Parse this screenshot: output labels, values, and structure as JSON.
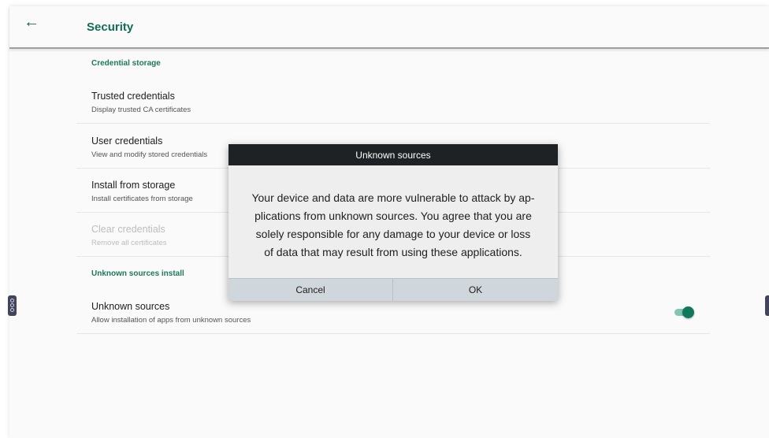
{
  "app": {
    "title": "Security",
    "back_icon": "arrow-left-icon",
    "accent_color": "#0f6e56"
  },
  "sections": {
    "credential_storage": "Credential storage",
    "unknown_sources_install": "Unknown sources install"
  },
  "prefs": {
    "trusted": {
      "title": "Trusted credentials",
      "summary": "Display trusted CA certificates"
    },
    "user": {
      "title": "User credentials",
      "summary": "View and modify stored credentials"
    },
    "install": {
      "title": "Install from storage",
      "summary": "Install certificates from storage"
    },
    "clear": {
      "title": "Clear credentials",
      "summary": "Remove all certificates",
      "enabled": false
    },
    "unknown": {
      "title": "Unknown sources",
      "summary": "Allow installation of apps from unknown sources",
      "toggle_on": true
    }
  },
  "dialog": {
    "title": "Unknown sources",
    "message_lines": [
      "Your device and data are more vulnerable to attack by ap-",
      "plications from unknown sources. You agree that you are",
      "solely responsible for any damage to your device or loss",
      "of data that may result from using these applications."
    ],
    "cancel_label": "Cancel",
    "ok_label": "OK"
  }
}
